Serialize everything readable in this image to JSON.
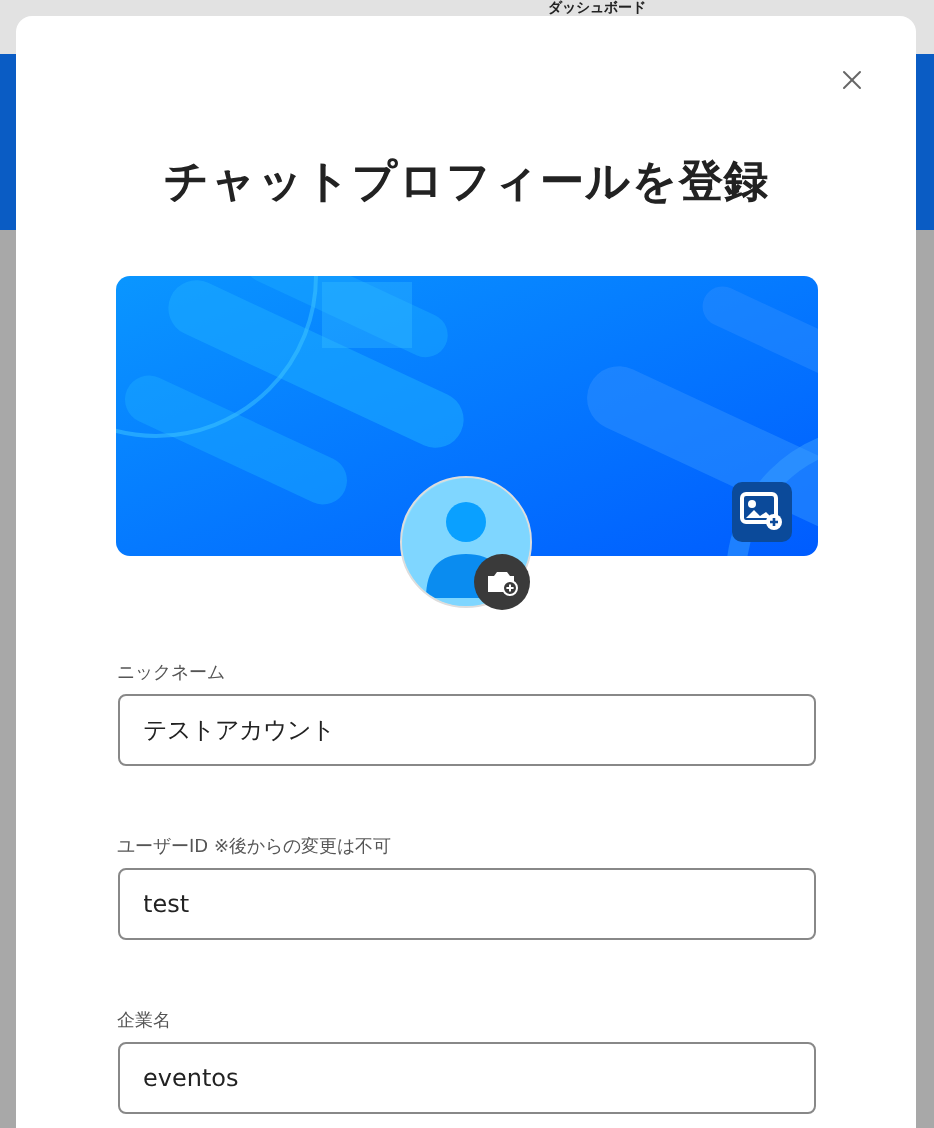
{
  "background_page": {
    "title": "ダッシュボード"
  },
  "dialog": {
    "title": "チャットプロフィールを登録",
    "fields": [
      {
        "label": "ニックネーム",
        "value": "テストアカウント"
      },
      {
        "label": "ユーザーID ※後からの変更は不可",
        "value": "test"
      },
      {
        "label": "企業名",
        "value": "eventos"
      }
    ]
  }
}
